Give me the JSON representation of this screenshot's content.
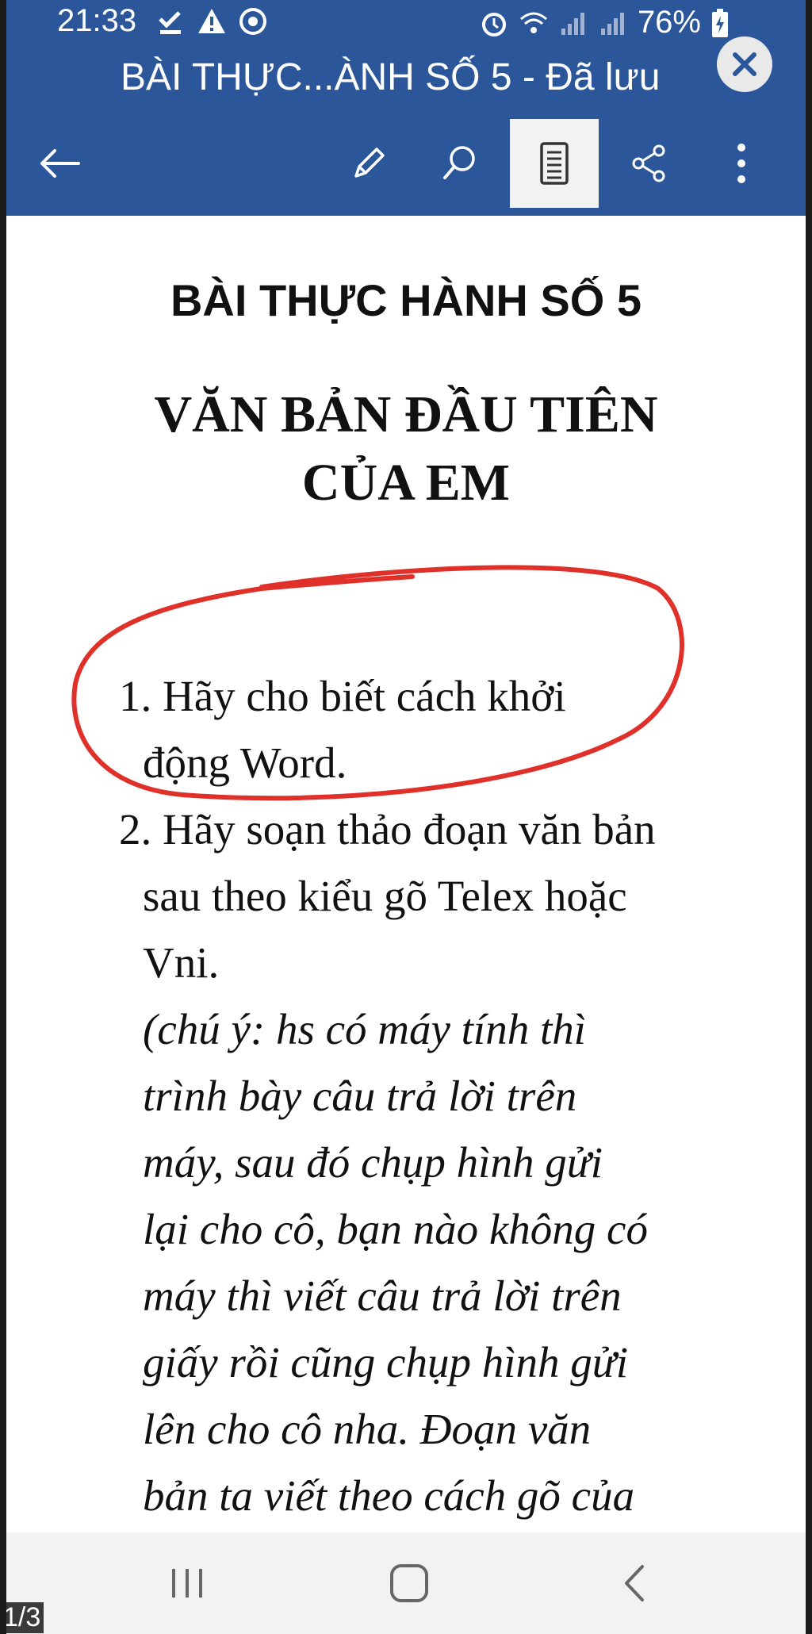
{
  "status_bar": {
    "time": "21:33",
    "battery": "76%"
  },
  "header": {
    "doc_title": "BÀI THỰC...ÀNH SỐ 5 - Đã lưu",
    "accent_color": "#2b579a"
  },
  "toolbar": {
    "icons": [
      "back-arrow-icon",
      "pencil-icon",
      "search-icon",
      "mobile-view-icon",
      "share-icon",
      "more-vert-icon"
    ]
  },
  "document": {
    "heading1": "BÀI THỰC HÀNH SỐ 5",
    "heading2_line1": "VĂN BẢN ĐẦU TIÊN",
    "heading2_line2": "CỦA EM",
    "item1_line1": "1. Hãy cho biết cách khởi",
    "item1_line2": "động Word.",
    "item2_line1": "2. Hãy soạn thảo đoạn văn bản",
    "item2_line2": "sau theo kiểu gõ Telex hoặc",
    "item2_line3": "Vni.",
    "note_lines": [
      "(chú ý: hs có máy tính thì",
      "trình bày câu trả lời trên",
      "máy, sau đó chụp hình gửi",
      "lại cho cô, bạn nào không có",
      "máy thì viết câu trả lời trên",
      "giấy rồi cũng chụp hình gửi",
      "lên cho cô nha. Đoạn văn",
      "bản ta viết theo cách gõ của"
    ],
    "annotation_color": "#e0302a"
  },
  "overlay": {
    "pager": "1/3"
  }
}
